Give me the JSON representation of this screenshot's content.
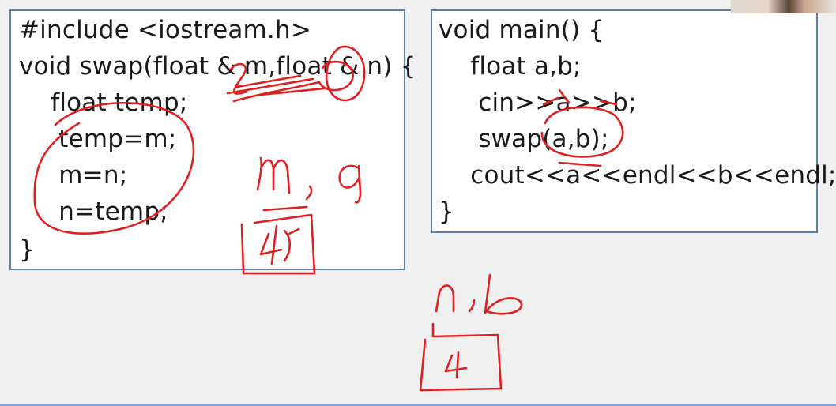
{
  "left_code": [
    "#include <iostream.h>",
    "void swap(float & m,float & n) {",
    "    float temp;",
    "     temp=m;",
    "     m=n;",
    "     n=temp;",
    "}"
  ],
  "right_code": [
    "void main() {",
    "    float a,b;",
    "     cin>>a>>b;",
    "     swap(a,b);",
    "    cout<<a<<endl<<b<<endl;",
    "}"
  ],
  "annotations": {
    "m_a_label": "m, a",
    "n_b_label": "n, b",
    "stack_box_top_value": "4",
    "stack_box_bottom_value": "4"
  },
  "colors": {
    "ink": "#e02020",
    "box_border": "#5b7fa8",
    "background": "#f0f0f0"
  }
}
